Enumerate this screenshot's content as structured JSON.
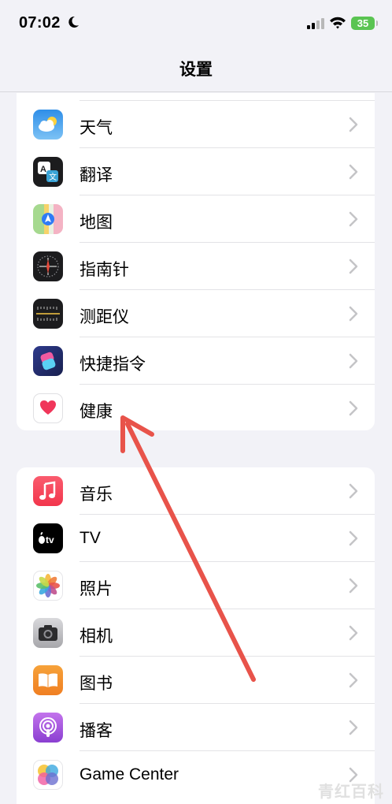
{
  "status_bar": {
    "time": "07:02",
    "battery": "35"
  },
  "nav": {
    "title": "设置"
  },
  "group1": [
    {
      "label": "天气",
      "icon": "weather-icon"
    },
    {
      "label": "翻译",
      "icon": "translate-icon"
    },
    {
      "label": "地图",
      "icon": "maps-icon"
    },
    {
      "label": "指南针",
      "icon": "compass-icon"
    },
    {
      "label": "测距仪",
      "icon": "measure-icon"
    },
    {
      "label": "快捷指令",
      "icon": "shortcuts-icon"
    },
    {
      "label": "健康",
      "icon": "health-icon"
    }
  ],
  "group2": [
    {
      "label": "音乐",
      "icon": "music-icon"
    },
    {
      "label": "TV",
      "icon": "tv-icon"
    },
    {
      "label": "照片",
      "icon": "photos-icon"
    },
    {
      "label": "相机",
      "icon": "camera-icon"
    },
    {
      "label": "图书",
      "icon": "books-icon"
    },
    {
      "label": "播客",
      "icon": "podcasts-icon"
    },
    {
      "label": "Game Center",
      "icon": "game-center-icon"
    }
  ],
  "colors": {
    "annotation_arrow": "#e8534a",
    "background": "#f2f2f7"
  },
  "watermark": "青红百科"
}
